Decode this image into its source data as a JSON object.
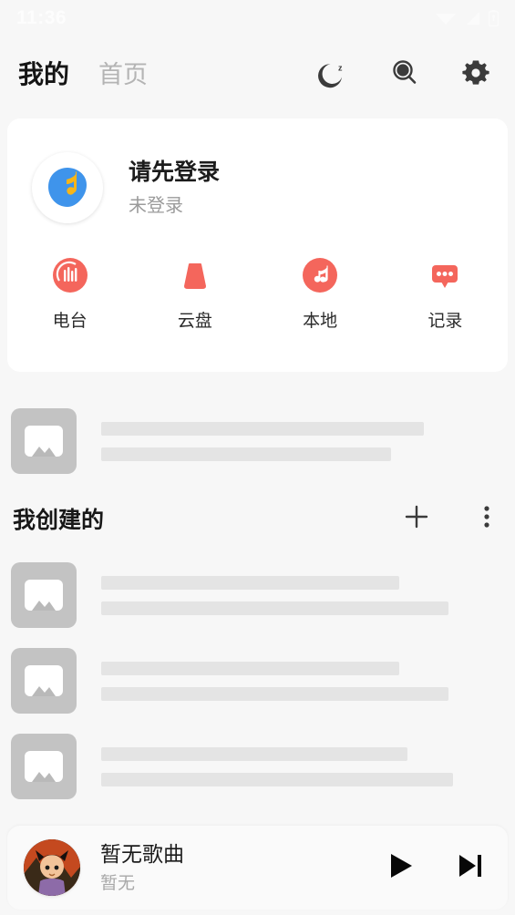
{
  "statusbar": {
    "time": "11:36",
    "icons": [
      "wifi-icon",
      "cellular-signal-icon",
      "battery-icon"
    ]
  },
  "header": {
    "tabs": [
      {
        "label": "我的",
        "active": true
      },
      {
        "label": "首页",
        "active": false
      }
    ],
    "actions": [
      {
        "name": "sleep-timer-icon",
        "label": "定时"
      },
      {
        "name": "search-icon",
        "label": "搜索"
      },
      {
        "name": "settings-gear-icon",
        "label": "设置"
      }
    ]
  },
  "profile": {
    "avatar_icon": "app-logo-avatar",
    "title": "请先登录",
    "subtitle": "未登录",
    "colors": {
      "avatar_shape": "#3f94eb",
      "avatar_note": "#f7b518"
    }
  },
  "quick_actions": [
    {
      "label": "电台",
      "icon": "radio-icon"
    },
    {
      "label": "云盘",
      "icon": "cloud-drive-icon"
    },
    {
      "label": "本地",
      "icon": "local-music-icon"
    },
    {
      "label": "记录",
      "icon": "history-icon"
    }
  ],
  "section": {
    "title": "我创建的",
    "add_icon": "plus-icon",
    "more_icon": "more-vertical-icon"
  },
  "skeletons": {
    "featured": {
      "line1_width": "78%",
      "line2_width": "70%"
    },
    "items": [
      {
        "line1_width": "72%",
        "line2_width": "84%"
      },
      {
        "line1_width": "72%",
        "line2_width": "84%"
      },
      {
        "line1_width": "74%",
        "line2_width": "85%"
      }
    ],
    "placeholder_icon": "image-placeholder-icon"
  },
  "player": {
    "album_art": "album-art-thumbnail",
    "title": "暂无歌曲",
    "subtitle": "暂无",
    "play_icon": "play-icon",
    "next_icon": "next-track-icon"
  },
  "theme": {
    "background": "#f7f7f7",
    "card": "#ffffff",
    "accent_red": "#f4665c",
    "text_primary": "#1b1b1b",
    "text_secondary": "#a0a0a0",
    "skeleton": "#e4e4e4"
  }
}
